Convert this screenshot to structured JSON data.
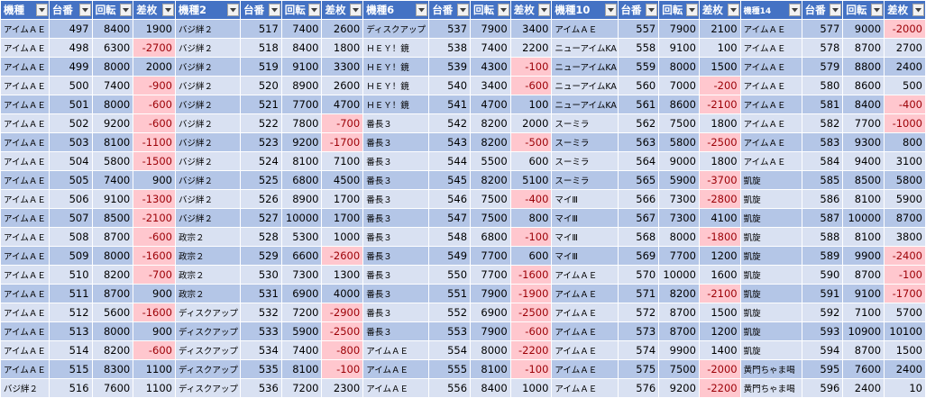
{
  "blocks": [
    {
      "headers": [
        "機種",
        "台番",
        "回転",
        "差枚"
      ],
      "rows": [
        [
          "アイムＡＥ",
          497,
          8400,
          1900
        ],
        [
          "アイムＡＥ",
          498,
          6300,
          -2700
        ],
        [
          "アイムＡＥ",
          499,
          8000,
          2000
        ],
        [
          "アイムＡＥ",
          500,
          7400,
          -900
        ],
        [
          "アイムＡＥ",
          501,
          8000,
          -600
        ],
        [
          "アイムＡＥ",
          502,
          9200,
          -600
        ],
        [
          "アイムＡＥ",
          503,
          8100,
          -1100
        ],
        [
          "アイムＡＥ",
          504,
          5800,
          -1500
        ],
        [
          "アイムＡＥ",
          505,
          7400,
          900
        ],
        [
          "アイムＡＥ",
          506,
          9100,
          -1300
        ],
        [
          "アイムＡＥ",
          507,
          8500,
          -2100
        ],
        [
          "アイムＡＥ",
          508,
          8700,
          -600
        ],
        [
          "アイムＡＥ",
          509,
          8000,
          -1600
        ],
        [
          "アイムＡＥ",
          510,
          8200,
          -700
        ],
        [
          "アイムＡＥ",
          511,
          8700,
          900
        ],
        [
          "アイムＡＥ",
          512,
          5600,
          -1600
        ],
        [
          "アイムＡＥ",
          513,
          8000,
          900
        ],
        [
          "アイムＡＥ",
          514,
          8200,
          -600
        ],
        [
          "アイムＡＥ",
          515,
          8300,
          1100
        ],
        [
          "バジ絆２",
          516,
          7600,
          1100
        ]
      ]
    },
    {
      "headers": [
        "機種2",
        "台番",
        "回転",
        "差枚"
      ],
      "rows": [
        [
          "バジ絆２",
          517,
          7400,
          2600
        ],
        [
          "バジ絆２",
          518,
          8400,
          1800
        ],
        [
          "バジ絆２",
          519,
          9100,
          3300
        ],
        [
          "バジ絆２",
          520,
          8900,
          2600
        ],
        [
          "バジ絆２",
          521,
          7700,
          4700
        ],
        [
          "バジ絆２",
          522,
          7800,
          -700
        ],
        [
          "バジ絆２",
          523,
          9200,
          -1700
        ],
        [
          "バジ絆２",
          524,
          8100,
          7100
        ],
        [
          "バジ絆２",
          525,
          6800,
          4500
        ],
        [
          "バジ絆２",
          526,
          8900,
          1700
        ],
        [
          "バジ絆２",
          527,
          10000,
          1700
        ],
        [
          "政宗２",
          528,
          5300,
          1000
        ],
        [
          "政宗２",
          529,
          6600,
          -2600
        ],
        [
          "政宗２",
          530,
          7300,
          1300
        ],
        [
          "政宗２",
          531,
          6900,
          4000
        ],
        [
          "ディスクアップ",
          532,
          7200,
          -2900
        ],
        [
          "ディスクアップ",
          533,
          5900,
          -2500
        ],
        [
          "ディスクアップ",
          534,
          7400,
          -800
        ],
        [
          "ディスクアップ",
          535,
          8100,
          -100
        ],
        [
          "ディスクアップ",
          536,
          7200,
          2300
        ]
      ]
    },
    {
      "headers": [
        "機種6",
        "台番",
        "回転",
        "差枚"
      ],
      "rows": [
        [
          "ディスクアップ",
          537,
          7900,
          3400
        ],
        [
          "ＨＥＹ！鏡",
          538,
          7400,
          2200
        ],
        [
          "ＨＥＹ！鏡",
          539,
          4300,
          -100
        ],
        [
          "ＨＥＹ！鏡",
          540,
          3400,
          -600
        ],
        [
          "ＨＥＹ！鏡",
          541,
          4700,
          100
        ],
        [
          "番長３",
          542,
          8200,
          2000
        ],
        [
          "番長３",
          543,
          8200,
          -500
        ],
        [
          "番長３",
          544,
          5500,
          600
        ],
        [
          "番長３",
          545,
          8200,
          5100
        ],
        [
          "番長３",
          546,
          7500,
          -400
        ],
        [
          "番長３",
          547,
          7500,
          800
        ],
        [
          "番長３",
          548,
          6800,
          -100
        ],
        [
          "番長３",
          549,
          7700,
          600
        ],
        [
          "番長３",
          550,
          7700,
          -1600
        ],
        [
          "番長３",
          551,
          7900,
          -1900
        ],
        [
          "番長３",
          552,
          6900,
          -2500
        ],
        [
          "番長３",
          553,
          7900,
          -600
        ],
        [
          "アイムＡＥ",
          554,
          8000,
          -2200
        ],
        [
          "アイムＡＥ",
          555,
          8100,
          -100
        ],
        [
          "アイムＡＥ",
          556,
          8400,
          1000
        ]
      ]
    },
    {
      "headers": [
        "機種10",
        "台番",
        "回転",
        "差枚"
      ],
      "rows": [
        [
          "アイムＡＥ",
          557,
          7900,
          2100
        ],
        [
          "ニューアイムKA",
          558,
          9100,
          100
        ],
        [
          "ニューアイムKA",
          559,
          8000,
          1500
        ],
        [
          "ニューアイムKA",
          560,
          7000,
          -200
        ],
        [
          "ニューアイムKA",
          561,
          8600,
          -2100
        ],
        [
          "スーミラ",
          562,
          7500,
          1800
        ],
        [
          "スーミラ",
          563,
          5800,
          -2500
        ],
        [
          "スーミラ",
          564,
          9000,
          1800
        ],
        [
          "スーミラ",
          565,
          5900,
          -3700
        ],
        [
          "マイⅢ",
          566,
          7300,
          -2800
        ],
        [
          "マイⅢ",
          567,
          7300,
          4100
        ],
        [
          "マイⅢ",
          568,
          8000,
          -1800
        ],
        [
          "マイⅢ",
          569,
          7700,
          1200
        ],
        [
          "アイムＡＥ",
          570,
          10000,
          1600
        ],
        [
          "アイムＡＥ",
          571,
          8200,
          -2100
        ],
        [
          "アイムＡＥ",
          572,
          8700,
          1500
        ],
        [
          "アイムＡＥ",
          573,
          8700,
          1200
        ],
        [
          "アイムＡＥ",
          574,
          9900,
          1400
        ],
        [
          "アイムＡＥ",
          575,
          7500,
          -2000
        ],
        [
          "アイムＡＥ",
          576,
          9200,
          -2200
        ]
      ]
    },
    {
      "headers": [
        "機種14",
        "台番",
        "回転",
        "差枚"
      ],
      "rows": [
        [
          "アイムＡＥ",
          577,
          9000,
          -2000
        ],
        [
          "アイムＡＥ",
          578,
          8700,
          2700
        ],
        [
          "アイムＡＥ",
          579,
          8800,
          2400
        ],
        [
          "アイムＡＥ",
          580,
          8600,
          500
        ],
        [
          "アイムＡＥ",
          581,
          8400,
          -400
        ],
        [
          "アイムＡＥ",
          582,
          7700,
          -1000
        ],
        [
          "アイムＡＥ",
          583,
          9300,
          800
        ],
        [
          "アイムＡＥ",
          584,
          9400,
          3100
        ],
        [
          "凱旋",
          585,
          8500,
          5800
        ],
        [
          "凱旋",
          586,
          8100,
          5900
        ],
        [
          "凱旋",
          587,
          10000,
          8700
        ],
        [
          "凱旋",
          588,
          8100,
          3800
        ],
        [
          "凱旋",
          589,
          9900,
          -2400
        ],
        [
          "凱旋",
          590,
          8700,
          -100
        ],
        [
          "凱旋",
          591,
          9100,
          -1700
        ],
        [
          "凱旋",
          592,
          7100,
          5700
        ],
        [
          "凱旋",
          593,
          10900,
          10100
        ],
        [
          "凱旋",
          594,
          8700,
          1500
        ],
        [
          "黄門ちゃま喝",
          595,
          7600,
          2400
        ],
        [
          "黄門ちゃま喝",
          596,
          2400,
          10
        ]
      ]
    }
  ]
}
